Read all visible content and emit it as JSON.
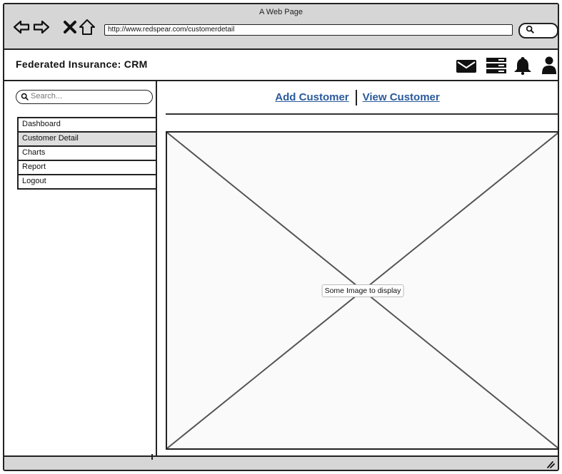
{
  "window": {
    "title": "A Web Page",
    "url": "http://www.redspear.com/customerdetail"
  },
  "header": {
    "brand": "Federated Insurance: CRM",
    "icons": [
      "mail-icon",
      "list-icon",
      "bell-icon",
      "user-icon"
    ]
  },
  "sidebar": {
    "search_placeholder": "Search...",
    "items": [
      {
        "label": "Dashboard",
        "active": false
      },
      {
        "label": "Customer Detail",
        "active": true
      },
      {
        "label": "Charts",
        "active": false
      },
      {
        "label": "Report",
        "active": false
      },
      {
        "label": "Logout",
        "active": false
      }
    ]
  },
  "main": {
    "links": {
      "add": "Add Customer",
      "view": "View Customer"
    },
    "image_label": "Some Image to display"
  }
}
